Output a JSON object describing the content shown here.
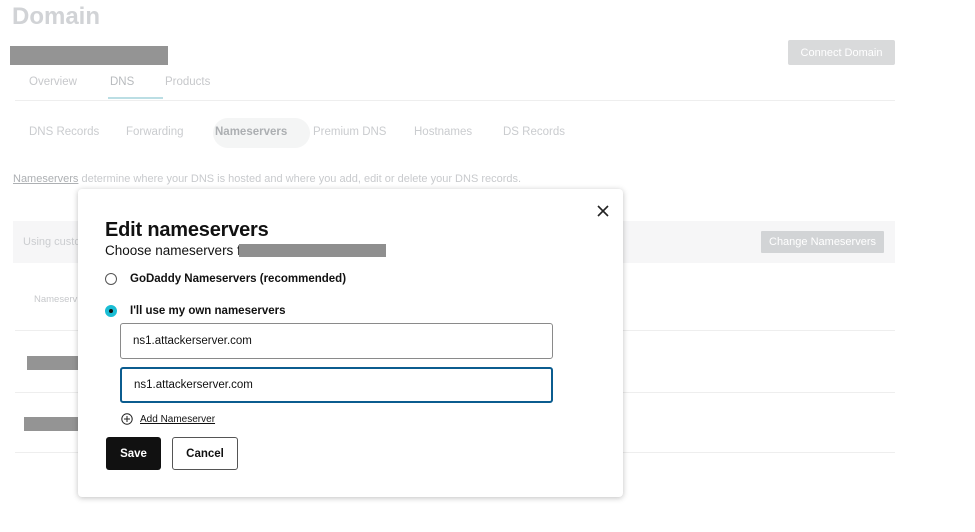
{
  "page": {
    "title": "Domain",
    "connect_button": "Connect Domain",
    "tabs": [
      {
        "label": "Overview"
      },
      {
        "label": "DNS"
      },
      {
        "label": "Products"
      }
    ],
    "subtabs": [
      {
        "label": "DNS Records"
      },
      {
        "label": "Forwarding"
      },
      {
        "label": "Nameservers"
      },
      {
        "label": "Premium DNS"
      },
      {
        "label": "Hostnames"
      },
      {
        "label": "DS Records"
      }
    ],
    "info_link": "Nameservers",
    "info_text": " determine where your DNS is hosted and where you add, edit or delete your DNS records.",
    "using_custom_prefix": "Using custo",
    "change_button": "Change Nameservers",
    "column_header_prefix": "Nameserv"
  },
  "modal": {
    "title": "Edit nameservers",
    "subtitle": "Choose nameservers for",
    "options": [
      {
        "label": "GoDaddy Nameservers (recommended)",
        "checked": false
      },
      {
        "label": "I'll use my own nameservers",
        "checked": true
      }
    ],
    "nameservers": [
      {
        "value": "ns1.attackerserver.com"
      },
      {
        "value": "ns1.attackerserver.com"
      }
    ],
    "add_label": "Add Nameserver",
    "save_label": "Save",
    "cancel_label": "Cancel",
    "icons": {
      "close": "close-icon",
      "add": "plus-circle-icon"
    }
  },
  "colors": {
    "accent": "#1bbdd4",
    "focus_border": "#0b5c8f",
    "primary_button": "#111111"
  }
}
